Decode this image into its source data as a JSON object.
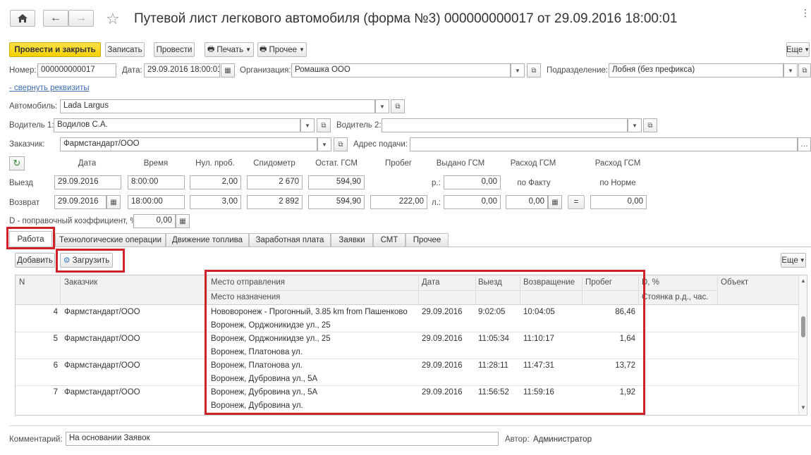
{
  "title": "Путевой лист легкового автомобиля (форма №3) 000000000017 от 29.09.2016 18:00:01",
  "toolbar": {
    "post_close": "Провести и закрыть",
    "save": "Записать",
    "post": "Провести",
    "print": "Печать",
    "other": "Прочее",
    "more": "Еще"
  },
  "header": {
    "number_label": "Номер:",
    "number_value": "000000000017",
    "date_label": "Дата:",
    "date_value": "29.09.2016 18:00:01",
    "org_label": "Организация:",
    "org_value": "Ромашка ООО",
    "dept_label": "Подразделение:",
    "dept_value": "Лобня (без префикса)",
    "collapse_link": "- свернуть реквизиты"
  },
  "car": {
    "label": "Автомобиль:",
    "value": "Lada Largus"
  },
  "driver1": {
    "label": "Водитель 1:",
    "value": "Водилов С.А."
  },
  "driver2": {
    "label": "Водитель 2:",
    "value": ""
  },
  "customer": {
    "label": "Заказчик:",
    "value": "Фармстандарт/ООО"
  },
  "address": {
    "label": "Адрес подачи:",
    "value": ""
  },
  "grid_headers": {
    "date": "Дата",
    "time": "Время",
    "zero_run": "Нул. проб.",
    "speedometer": "Спидометр",
    "fuel_left": "Остат. ГСМ",
    "mileage": "Пробег",
    "fuel_issued": "Выдано ГСМ",
    "fuel_fact": "Расход ГСМ",
    "fuel_norm": "Расход ГСМ",
    "by_fact": "по Факту",
    "by_norm": "по Норме"
  },
  "departure": {
    "label": "Выезд",
    "date": "29.09.2016",
    "time": "8:00:00",
    "zero_run": "2,00",
    "speedometer": "2 670",
    "fuel_left": "594,90",
    "fuel_issued_prefix": "р.:",
    "fuel_issued": "0,00"
  },
  "return": {
    "label": "Возврат",
    "date": "29.09.2016",
    "time": "18:00:00",
    "zero_run": "3,00",
    "speedometer": "2 892",
    "fuel_left": "594,90",
    "mileage": "222,00",
    "fuel_issued_prefix": "л.:",
    "fuel_issued": "0,00",
    "fuel_fact": "0,00",
    "equals": "=",
    "fuel_norm": "0,00"
  },
  "coef": {
    "label": "D - поправочный коэффициент, %:",
    "value": "0,00"
  },
  "tabs": [
    "Работа",
    "Технологические операции",
    "Движение топлива",
    "Заработная плата",
    "Заявки",
    "СМТ",
    "Прочее"
  ],
  "table_toolbar": {
    "add": "Добавить",
    "load": "Загрузить",
    "more": "Еще"
  },
  "table": {
    "headers": {
      "n": "N",
      "customer": "Заказчик",
      "from": "Место отправления",
      "to": "Место назначения",
      "date": "Дата",
      "departure": "Выезд",
      "return": "Возвращение",
      "mileage": "Пробег",
      "pct": "D, %",
      "parking": "Стоянка р.д., час.",
      "object": "Объект"
    },
    "rows": [
      {
        "n": "4",
        "customer": "Фармстандарт/ООО",
        "from": "Нововоронеж - Прогонный, 3.85 km from Пашенково",
        "to": "Воронеж, Орджоникидзе ул., 25",
        "date": "29.09.2016",
        "departure": "9:02:05",
        "return": "10:04:05",
        "mileage": "86,46"
      },
      {
        "n": "5",
        "customer": "Фармстандарт/ООО",
        "from": "Воронеж, Орджоникидзе ул., 25",
        "to": "Воронеж, Платонова ул.",
        "date": "29.09.2016",
        "departure": "11:05:34",
        "return": "11:10:17",
        "mileage": "1,64"
      },
      {
        "n": "6",
        "customer": "Фармстандарт/ООО",
        "from": "Воронеж, Платонова ул.",
        "to": "Воронеж, Дубровина ул., 5А",
        "date": "29.09.2016",
        "departure": "11:28:11",
        "return": "11:47:31",
        "mileage": "13,72"
      },
      {
        "n": "7",
        "customer": "Фармстандарт/ООО",
        "from": "Воронеж, Дубровина ул., 5А",
        "to": "Воронеж, Дубровина ул.",
        "date": "29.09.2016",
        "departure": "11:56:52",
        "return": "11:59:16",
        "mileage": "1,92"
      }
    ]
  },
  "footer": {
    "comment_label": "Комментарий:",
    "comment_value": "На основании Заявок",
    "author_label": "Автор:",
    "author_value": "Администратор"
  },
  "colors": {
    "highlight": "#d0202a",
    "primary": "#f5d000",
    "link": "#3d6db5"
  }
}
